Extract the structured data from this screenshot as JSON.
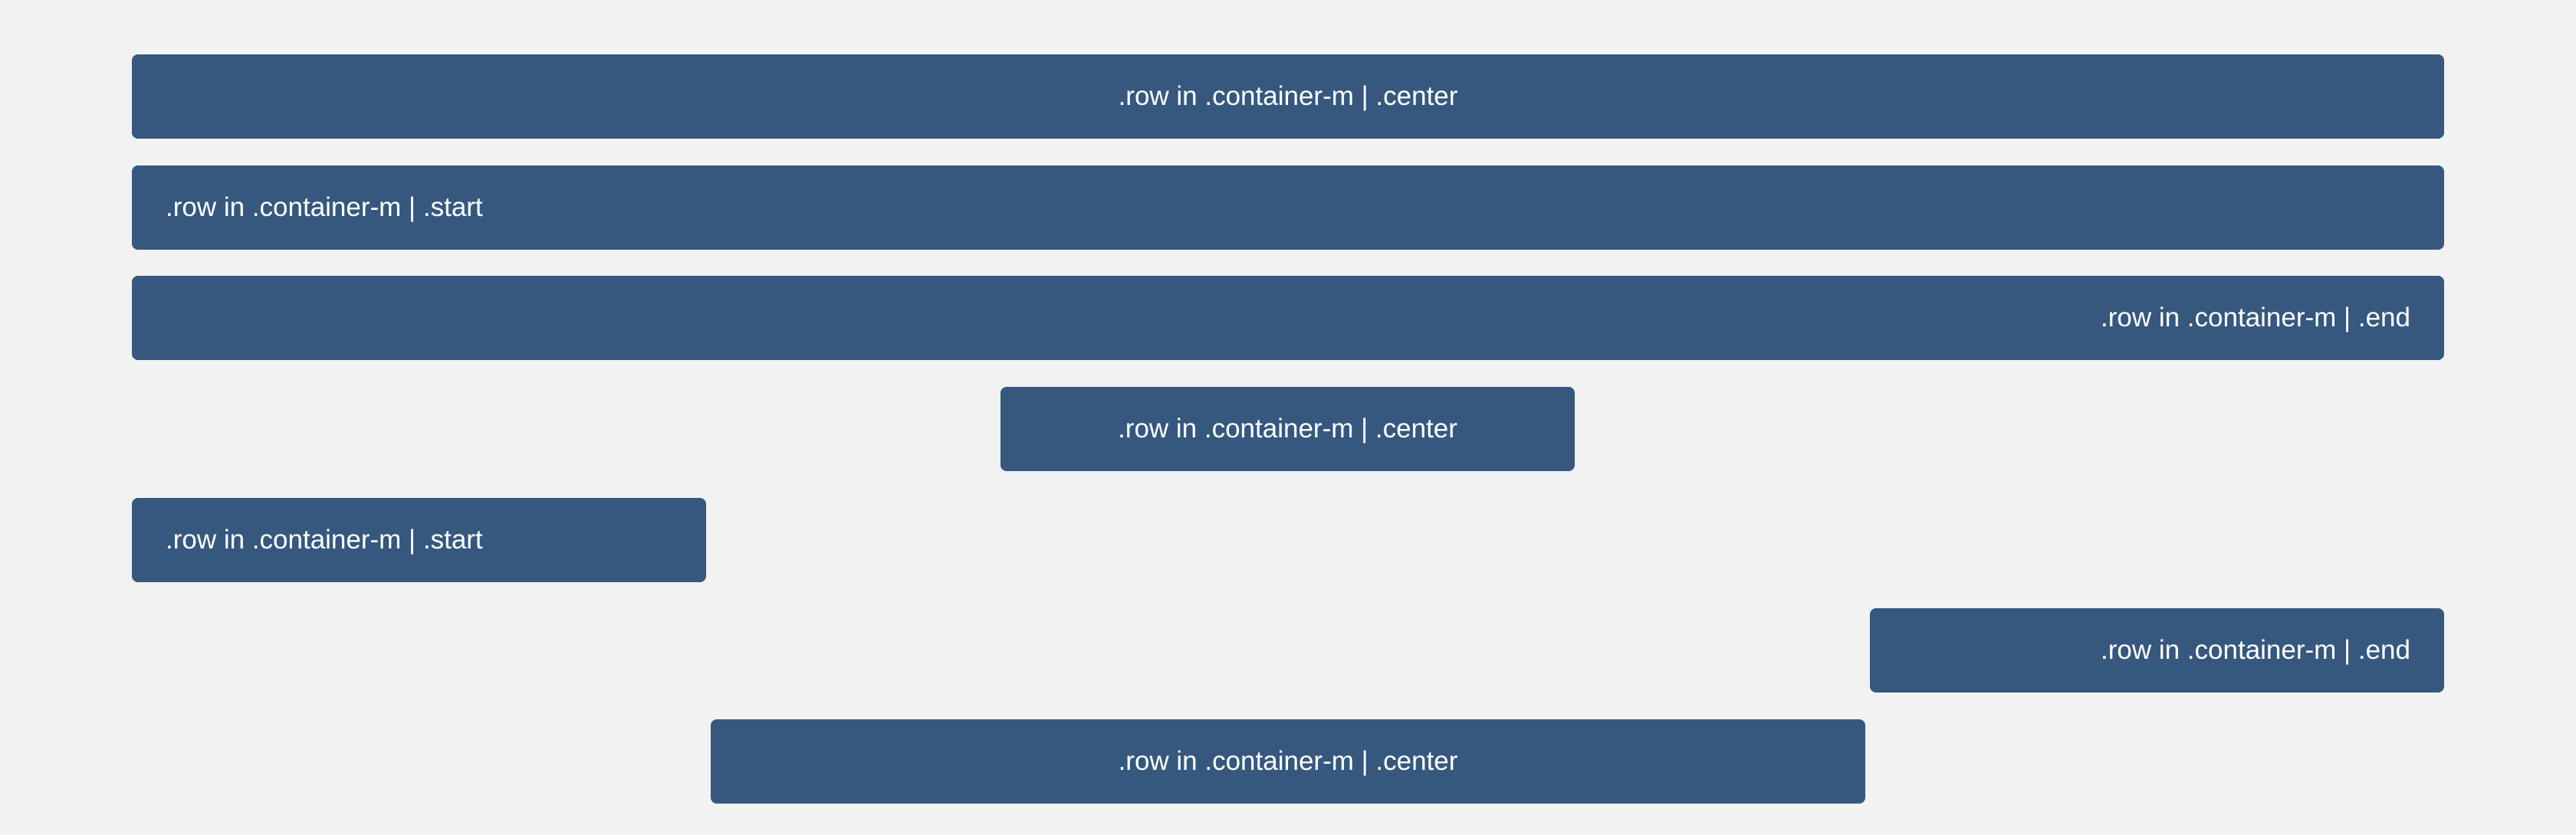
{
  "rows": [
    {
      "label": ".row in .container-m | .center",
      "align": "center"
    },
    {
      "label": ".row in .container-m | .start",
      "align": "start"
    },
    {
      "label": ".row in .container-m | .end",
      "align": "end"
    },
    {
      "label": ".row in .container-m | .center",
      "align": "center"
    },
    {
      "label": ".row in .container-m | .start",
      "align": "start"
    },
    {
      "label": ".row in .container-m | .end",
      "align": "end"
    },
    {
      "label": ".row in .container-m | .center",
      "align": "center"
    }
  ],
  "colors": {
    "background": "#f2f2f2",
    "row": "#36587f",
    "text": "#ffffff"
  }
}
